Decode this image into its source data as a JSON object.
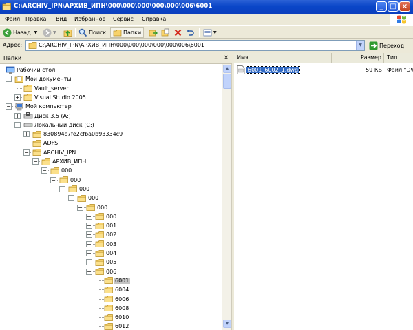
{
  "window": {
    "title": "C:\\ARCHIV_IPN\\АРХИВ_ИПН\\000\\000\\000\\000\\000\\006\\6001",
    "controls": [
      "_",
      "□",
      "×"
    ]
  },
  "menu": [
    "Файл",
    "Правка",
    "Вид",
    "Избранное",
    "Сервис",
    "Справка"
  ],
  "toolbar": {
    "back": "Назад",
    "search": "Поиск",
    "folders": "Папки"
  },
  "address": {
    "label": "Адрес:",
    "value": "C:\\ARCHIV_IPN\\АРХИВ_ИПН\\000\\000\\000\\000\\000\\006\\6001",
    "go": "Переход"
  },
  "tree": {
    "title": "Папки",
    "close": "×",
    "nodes": [
      {
        "label": "Рабочий стол",
        "icon": "desktop-icon",
        "expander": ""
      },
      {
        "label": "Мои документы",
        "icon": "my-documents-icon",
        "expander": "−"
      },
      {
        "label": "Vault_server",
        "icon": "folder-icon",
        "expander": ""
      },
      {
        "label": "Visual Studio 2005",
        "icon": "folder-icon",
        "expander": "+"
      },
      {
        "label": "Мой компьютер",
        "icon": "my-computer-icon",
        "expander": "−"
      },
      {
        "label": "Диск 3,5 (A:)",
        "icon": "floppy-drive-icon",
        "expander": "+"
      },
      {
        "label": "Локальный диск (C:)",
        "icon": "hard-drive-icon",
        "expander": "−"
      },
      {
        "label": "830894c7fe2cfba0b93334c9",
        "icon": "folder-icon",
        "expander": "+"
      },
      {
        "label": "ADFS",
        "icon": "folder-icon",
        "expander": ""
      },
      {
        "label": "ARCHIV_IPN",
        "icon": "folder-icon",
        "expander": "−"
      },
      {
        "label": "АРХИВ_ИПН",
        "icon": "folder-icon",
        "expander": "−"
      },
      {
        "label": "000",
        "icon": "folder-icon",
        "expander": "−"
      },
      {
        "label": "000",
        "icon": "folder-icon",
        "expander": "−"
      },
      {
        "label": "000",
        "icon": "folder-icon",
        "expander": "−"
      },
      {
        "label": "000",
        "icon": "folder-icon",
        "expander": "−"
      },
      {
        "label": "000",
        "icon": "folder-icon",
        "expander": "−"
      },
      {
        "label": "000",
        "icon": "folder-icon",
        "expander": "+"
      },
      {
        "label": "001",
        "icon": "folder-icon",
        "expander": "+"
      },
      {
        "label": "002",
        "icon": "folder-icon",
        "expander": "+"
      },
      {
        "label": "003",
        "icon": "folder-icon",
        "expander": "+"
      },
      {
        "label": "004",
        "icon": "folder-icon",
        "expander": "+"
      },
      {
        "label": "005",
        "icon": "folder-icon",
        "expander": "+"
      },
      {
        "label": "006",
        "icon": "folder-icon",
        "expander": "−"
      },
      {
        "label": "6001",
        "icon": "folder-icon",
        "expander": "",
        "selected": true
      },
      {
        "label": "6004",
        "icon": "folder-icon",
        "expander": ""
      },
      {
        "label": "6006",
        "icon": "folder-icon",
        "expander": ""
      },
      {
        "label": "6008",
        "icon": "folder-icon",
        "expander": ""
      },
      {
        "label": "6010",
        "icon": "folder-icon",
        "expander": ""
      },
      {
        "label": "6012",
        "icon": "folder-icon",
        "expander": ""
      }
    ]
  },
  "list": {
    "columns": [
      "Имя",
      "Размер",
      "Тип"
    ],
    "rows": [
      {
        "name": "6001_6002_1.dwg",
        "size": "59 КБ",
        "type": "Файл \"DW"
      }
    ]
  },
  "colors": {
    "titlebar": "#0a46c8",
    "selection": "#316ac5",
    "folder": "#f7d26b",
    "go_arrow": "#2e9a2e"
  }
}
